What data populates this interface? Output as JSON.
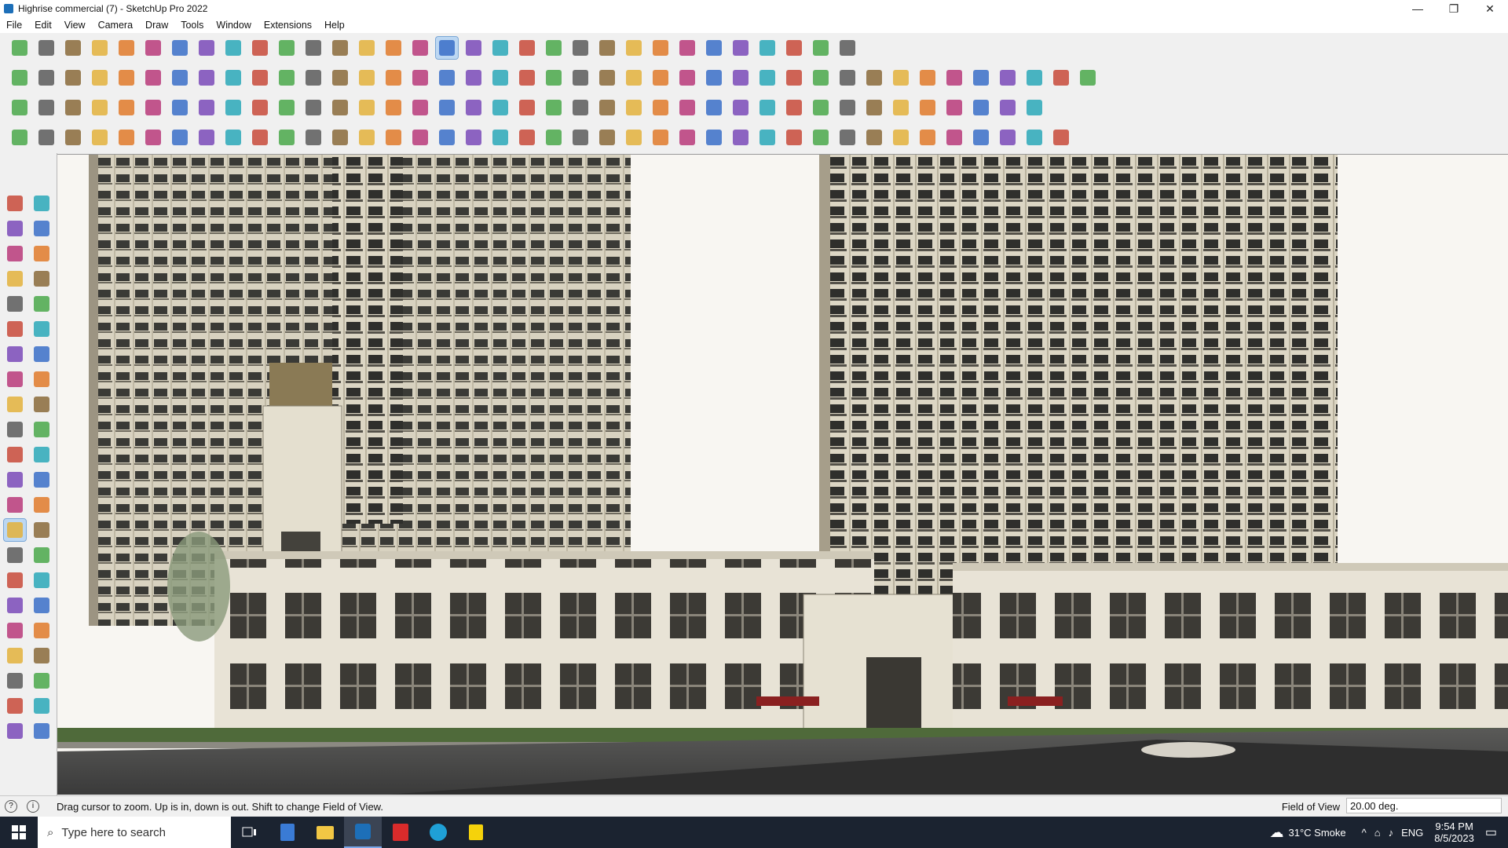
{
  "window": {
    "title": "Highrise commercial (7) - SketchUp Pro 2022",
    "minimize": "—",
    "maximize": "❐",
    "close": "✕"
  },
  "menu": [
    "File",
    "Edit",
    "View",
    "Camera",
    "Draw",
    "Tools",
    "Window",
    "Extensions",
    "Help"
  ],
  "toolbar_colors": [
    "#c84a3a",
    "#3a6fc8",
    "#e3b23c",
    "#4aa84a",
    "#7a4ab8",
    "#e07a2a",
    "#5a5a5a",
    "#2aa8b8",
    "#b83a7a",
    "#8a6a3a"
  ],
  "status": {
    "hint": "Drag cursor to zoom.  Up is in, down is out. Shift to change Field of View.",
    "vcb_label": "Field of View",
    "vcb_value": "20.00 deg."
  },
  "taskbar": {
    "search_placeholder": "Type here to search",
    "weather": "31°C  Smoke",
    "lang": "ENG",
    "time": "9:54 PM",
    "date": "8/5/2023"
  }
}
